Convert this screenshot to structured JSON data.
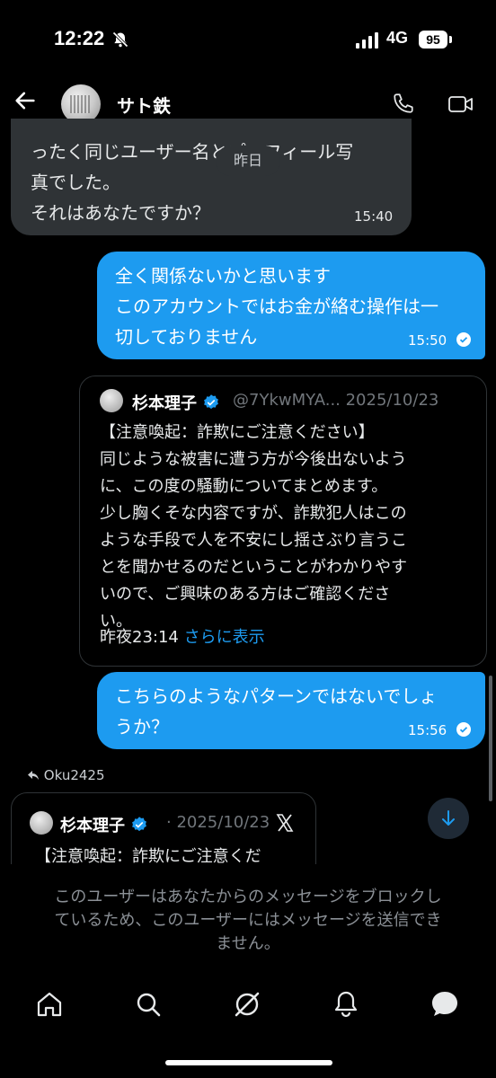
{
  "status_bar": {
    "time": "12:22",
    "network": "4G",
    "battery": "95"
  },
  "header": {
    "contact_name": "サト鉄"
  },
  "date_separator": "昨日",
  "messages": [
    {
      "lines": [
        "ったく同じユーザー名とプロフィール写",
        "真でした。",
        "それはあなたですか？"
      ],
      "time": "15:40"
    },
    {
      "lines": [
        "全く関係ないかと思います",
        "このアカウントではお金が絡む操作は一",
        "切しておりません"
      ],
      "time": "15:50"
    },
    {
      "lines": [
        "こちらのようなパターンではないでしょ",
        "うか？"
      ],
      "time": "15:56"
    }
  ],
  "quoted_post": {
    "name": "杉本理子",
    "handle_date": "@7YkwMYA... 2025/10/23",
    "lines": [
      "【注意喚起：詐欺にご注意ください】",
      "同じような被害に遭う方が今後出ないよう",
      "に、この度の騒動についてまとめます。",
      "少し胸くそな内容ですが、詐欺犯人はこの",
      "ような手段で人を不安にし揺さぶり言うこ",
      "とを聞かせるのだということがわかりやす",
      "いので、ご興味のある方はご確認くださ",
      "い。"
    ],
    "time": "昨夜23:14",
    "more": "さらに表示"
  },
  "reply_label": "Oku2425",
  "shared_post": {
    "name": "杉本理子",
    "date": "· 2025/10/23",
    "text": "【注意喚起：詐欺にご注意くだ"
  },
  "blocked_notice": [
    "このユーザーはあなたからのメッセージをブロックし",
    "ているため、このユーザーにはメッセージを送信でき",
    "ません。"
  ],
  "icons": [
    "back-arrow-icon",
    "phone-icon",
    "video-icon",
    "verified-icon",
    "x-logo-icon",
    "arrow-down-icon",
    "home-icon",
    "search-icon",
    "grok-icon",
    "bell-icon",
    "messages-icon"
  ],
  "colors": {
    "accent": "#1d9bf0",
    "incoming_bubble": "#2f3336",
    "background": "#000000"
  }
}
